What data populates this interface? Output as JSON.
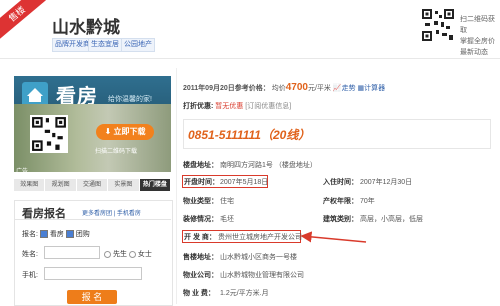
{
  "header": {
    "ribbon": "售楼",
    "title": "山水黔城",
    "tags": [
      "品牌开发商",
      "生态宜居",
      "公园地产"
    ],
    "qr_text": [
      "扫二维码获取",
      "掌握全房价",
      "最新动态"
    ]
  },
  "sidebar": {
    "brand": "看房",
    "slogan": "给你温馨的家!",
    "download_label": "立即下载",
    "download_sub": "扫描二维码下载",
    "ad_label": "广告",
    "tabs": [
      "效果图",
      "规划图",
      "交通图",
      "实景图",
      "热门楼盘"
    ],
    "register": {
      "title": "看房报名",
      "links": "更多看房团 | 手机看房",
      "name_label": "报名:",
      "opt1": "看房",
      "opt2": "团购",
      "name_field_label": "姓名:",
      "gender_m": "先生",
      "gender_f": "女士",
      "phone_label": "手机:",
      "submit": "报 名"
    }
  },
  "main": {
    "price_prefix": "2011年09月20日参考价格：",
    "price_avg": "均价",
    "price_value": "4700",
    "price_unit": "元/平米",
    "trend": "走势",
    "calculator": "计算器",
    "promo_label": "打折优惠:",
    "promo_value": "暂无优惠",
    "promo_link": "[订阅优惠信息]",
    "phone": "0851-5111111（20线）",
    "address_label": "楼盘地址：",
    "address_value": "南明四方河路1号 （楼盘地址）",
    "open_label": "开盘时间：",
    "open_value": "2007年5月18日",
    "move_label": "入住时间：",
    "move_value": "2007年12月30日",
    "type_label": "物业类型：",
    "type_value": "住宅",
    "years_label": "产权年限：",
    "years_value": "70年",
    "deco_label": "装修情况：",
    "deco_value": "毛坯",
    "arch_label": "建筑类别：",
    "arch_value": "高层，小高层，低层",
    "dev_label": "开 发 商：",
    "dev_value": "贵州世立城房地产开发公司",
    "sales_label": "售楼地址：",
    "sales_value": "山水黔城小区商务一号楼",
    "mgmt_label": "物业公司：",
    "mgmt_value": "山水黔城物业管理有限公司",
    "fee_label": "物 业 费：",
    "fee_value": "1.2元/平方米.月"
  },
  "colors": {
    "accent": "#e0621b",
    "highlight": "#d93a2b",
    "link": "#2f5fa8"
  }
}
